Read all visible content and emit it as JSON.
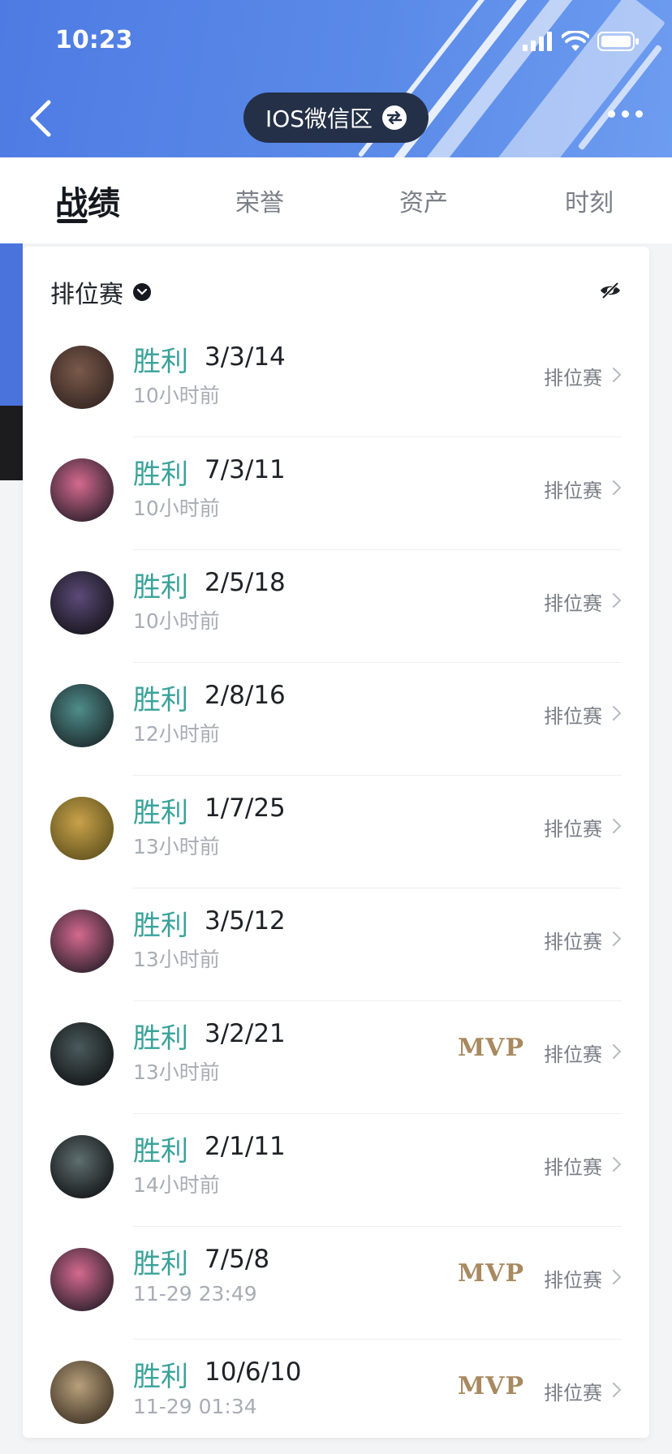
{
  "status_bar": {
    "time": "10:23"
  },
  "header": {
    "region_label": "IOS微信区"
  },
  "tabs": [
    {
      "label": "战绩",
      "active": true
    },
    {
      "label": "荣誉",
      "active": false
    },
    {
      "label": "资产",
      "active": false
    },
    {
      "label": "时刻",
      "active": false
    }
  ],
  "filter": {
    "label": "排位赛"
  },
  "colors": {
    "win": "#3aa39a",
    "header_blue": "#5a8ae8",
    "mvp_gold": "#a88960",
    "pill": "#243047"
  },
  "matches": [
    {
      "result": "胜利",
      "kda": "3/3/14",
      "time": "10小时前",
      "mode": "排位赛",
      "mvp": "",
      "avatar_icon": "champion-avatar-icon"
    },
    {
      "result": "胜利",
      "kda": "7/3/11",
      "time": "10小时前",
      "mode": "排位赛",
      "mvp": "",
      "avatar_icon": "champion-avatar-icon"
    },
    {
      "result": "胜利",
      "kda": "2/5/18",
      "time": "10小时前",
      "mode": "排位赛",
      "mvp": "",
      "avatar_icon": "champion-avatar-icon"
    },
    {
      "result": "胜利",
      "kda": "2/8/16",
      "time": "12小时前",
      "mode": "排位赛",
      "mvp": "",
      "avatar_icon": "champion-avatar-icon"
    },
    {
      "result": "胜利",
      "kda": "1/7/25",
      "time": "13小时前",
      "mode": "排位赛",
      "mvp": "",
      "avatar_icon": "champion-avatar-icon"
    },
    {
      "result": "胜利",
      "kda": "3/5/12",
      "time": "13小时前",
      "mode": "排位赛",
      "mvp": "",
      "avatar_icon": "champion-avatar-icon"
    },
    {
      "result": "胜利",
      "kda": "3/2/21",
      "time": "13小时前",
      "mode": "排位赛",
      "mvp": "MVP",
      "avatar_icon": "champion-avatar-icon"
    },
    {
      "result": "胜利",
      "kda": "2/1/11",
      "time": "14小时前",
      "mode": "排位赛",
      "mvp": "",
      "avatar_icon": "champion-avatar-icon"
    },
    {
      "result": "胜利",
      "kda": "7/5/8",
      "time": "11-29 23:49",
      "mode": "排位赛",
      "mvp": "MVP",
      "avatar_icon": "champion-avatar-icon"
    },
    {
      "result": "胜利",
      "kda": "10/6/10",
      "time": "11-29 01:34",
      "mode": "排位赛",
      "mvp": "MVP",
      "avatar_icon": "champion-avatar-icon"
    }
  ]
}
